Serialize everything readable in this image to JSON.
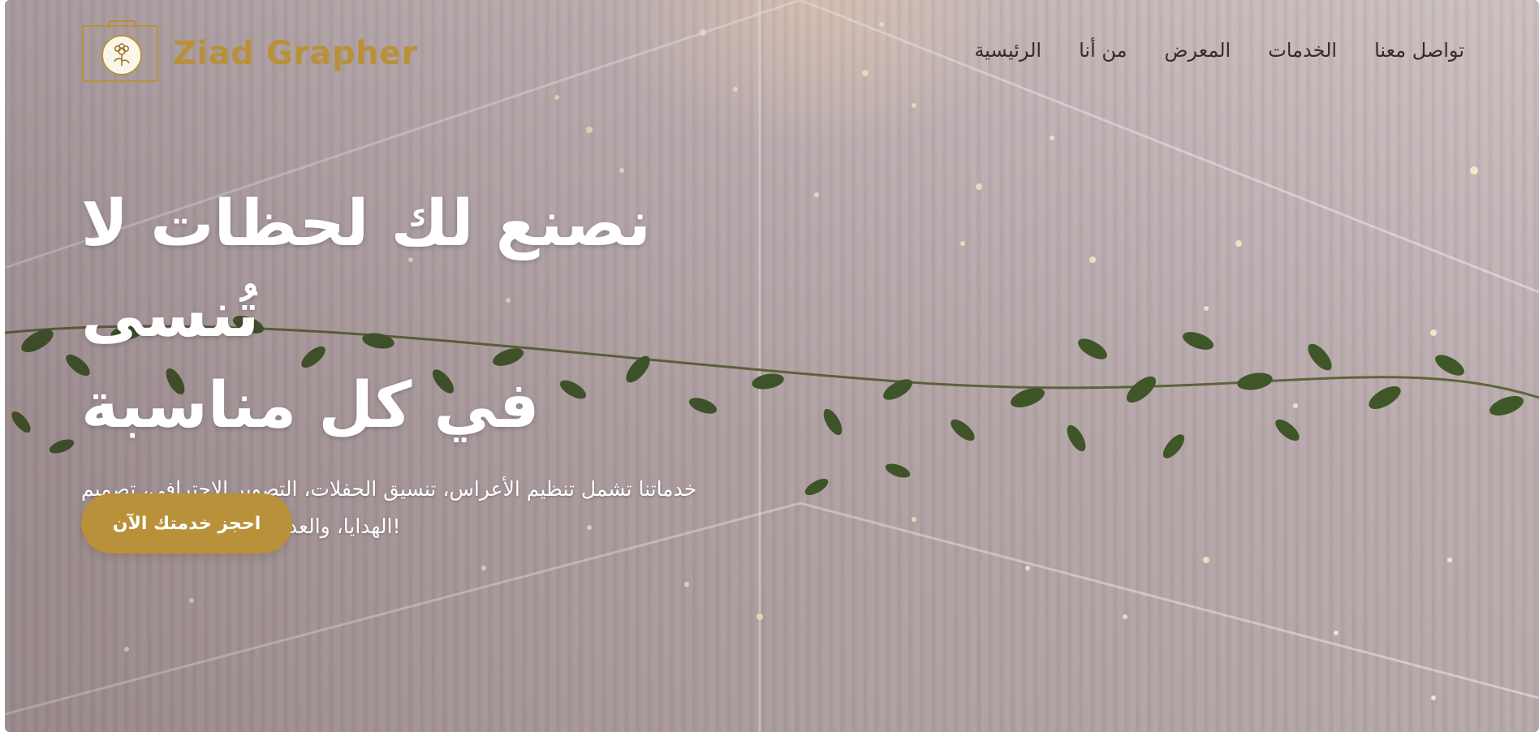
{
  "brand": {
    "name": "Ziad Grapher",
    "logo_icon": "camera-flower-icon",
    "accent_color": "#b8913a"
  },
  "nav": {
    "items": [
      {
        "label": "تواصل معنا"
      },
      {
        "label": "الخدمات"
      },
      {
        "label": "المعرض"
      },
      {
        "label": "من أنا"
      },
      {
        "label": "الرئيسية"
      }
    ]
  },
  "hero": {
    "title_line1": "نصنع لك لحظات لا تُنسى",
    "title_line2": "في كل مناسبة",
    "description_line1": "خدماتنا تشمل تنظيم الأعراس، تنسيق الحفلات، التصوير الاحترافي، تصميم",
    "description_line2": "الهدايا، والعديد من المفاجآت السعيدة!",
    "cta_label": "احجز خدمتك الآن",
    "background": "wedding-tent-ceiling-with-lights-and-greenery"
  }
}
